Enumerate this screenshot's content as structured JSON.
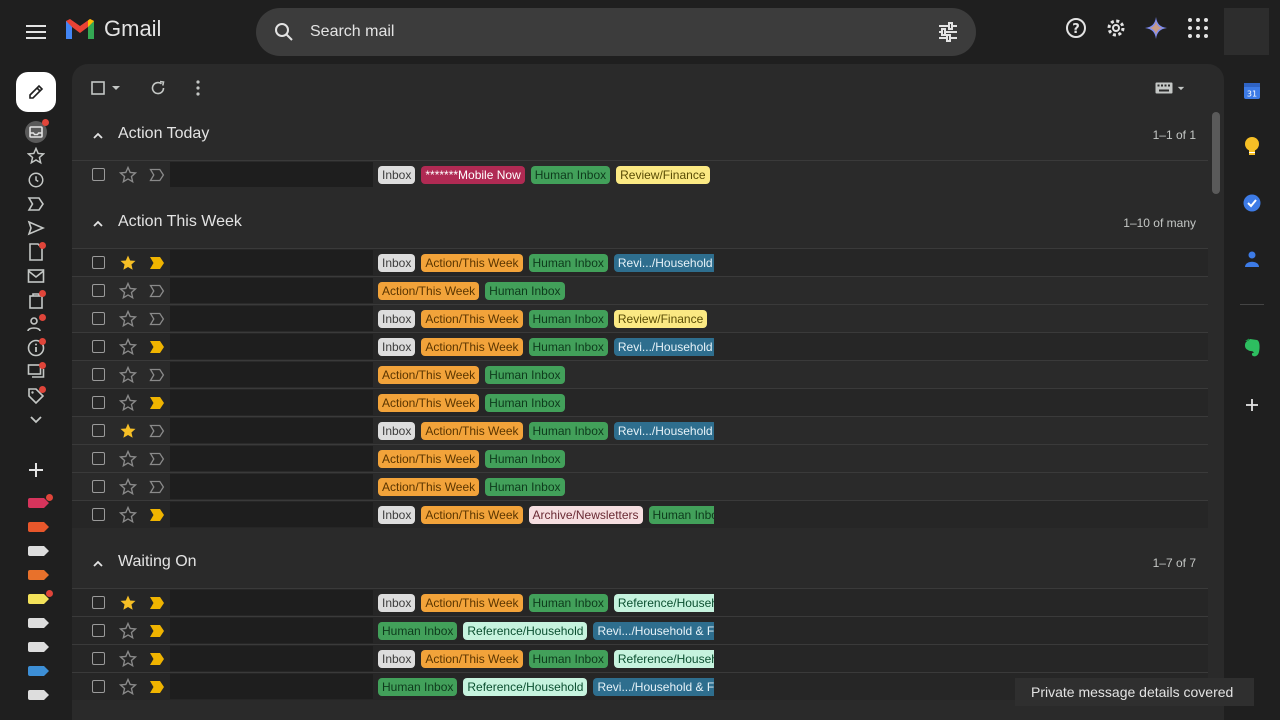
{
  "app": {
    "name": "Gmail"
  },
  "search": {
    "placeholder": "Search mail"
  },
  "sections": [
    {
      "title": "Action Today",
      "count": "1–1 of 1"
    },
    {
      "title": "Action This Week",
      "count": "1–10 of many"
    },
    {
      "title": "Waiting On",
      "count": "1–7 of 7"
    }
  ],
  "rows_today": [
    {
      "starred": false,
      "important": false,
      "labels": [
        {
          "text": "Inbox",
          "cls": "inbox"
        },
        {
          "text": "*******Mobile Now",
          "cls": "mobile"
        },
        {
          "text": "Human Inbox",
          "cls": "human"
        },
        {
          "text": "Review/Finance",
          "cls": "finance"
        }
      ]
    }
  ],
  "rows_week": [
    {
      "starred": true,
      "important": true,
      "labels": [
        {
          "text": "Inbox",
          "cls": "inbox"
        },
        {
          "text": "Action/This Week",
          "cls": "action"
        },
        {
          "text": "Human Inbox",
          "cls": "human"
        },
        {
          "text": "Revi.../Household",
          "cls": "household"
        }
      ]
    },
    {
      "starred": false,
      "important": false,
      "labels": [
        {
          "text": "Action/This Week",
          "cls": "action"
        },
        {
          "text": "Human Inbox",
          "cls": "human"
        }
      ]
    },
    {
      "starred": false,
      "important": false,
      "labels": [
        {
          "text": "Inbox",
          "cls": "inbox"
        },
        {
          "text": "Action/This Week",
          "cls": "action"
        },
        {
          "text": "Human Inbox",
          "cls": "human"
        },
        {
          "text": "Review/Finance",
          "cls": "finance"
        }
      ]
    },
    {
      "starred": false,
      "important": true,
      "labels": [
        {
          "text": "Inbox",
          "cls": "inbox"
        },
        {
          "text": "Action/This Week",
          "cls": "action"
        },
        {
          "text": "Human Inbox",
          "cls": "human"
        },
        {
          "text": "Revi.../Household",
          "cls": "household"
        }
      ]
    },
    {
      "starred": false,
      "important": false,
      "labels": [
        {
          "text": "Action/This Week",
          "cls": "action"
        },
        {
          "text": "Human Inbox",
          "cls": "human"
        }
      ]
    },
    {
      "starred": false,
      "important": true,
      "labels": [
        {
          "text": "Action/This Week",
          "cls": "action"
        },
        {
          "text": "Human Inbox",
          "cls": "human"
        }
      ]
    },
    {
      "starred": true,
      "important": false,
      "labels": [
        {
          "text": "Inbox",
          "cls": "inbox"
        },
        {
          "text": "Action/This Week",
          "cls": "action"
        },
        {
          "text": "Human Inbox",
          "cls": "human"
        },
        {
          "text": "Revi.../Household",
          "cls": "household"
        }
      ]
    },
    {
      "starred": false,
      "important": false,
      "labels": [
        {
          "text": "Action/This Week",
          "cls": "action"
        },
        {
          "text": "Human Inbox",
          "cls": "human"
        }
      ]
    },
    {
      "starred": false,
      "important": false,
      "labels": [
        {
          "text": "Action/This Week",
          "cls": "action"
        },
        {
          "text": "Human Inbox",
          "cls": "human"
        }
      ]
    },
    {
      "starred": false,
      "important": true,
      "labels": [
        {
          "text": "Inbox",
          "cls": "inbox"
        },
        {
          "text": "Action/This Week",
          "cls": "action"
        },
        {
          "text": "Archive/Newsletters",
          "cls": "news"
        },
        {
          "text": "Human Inbox",
          "cls": "human"
        }
      ]
    }
  ],
  "rows_waiting": [
    {
      "starred": true,
      "important": true,
      "labels": [
        {
          "text": "Inbox",
          "cls": "inbox"
        },
        {
          "text": "Action/This Week",
          "cls": "action"
        },
        {
          "text": "Human Inbox",
          "cls": "human"
        },
        {
          "text": "Reference/Household",
          "cls": "ref"
        }
      ]
    },
    {
      "starred": false,
      "important": true,
      "labels": [
        {
          "text": "Human Inbox",
          "cls": "human"
        },
        {
          "text": "Reference/Household",
          "cls": "ref"
        },
        {
          "text": "Revi.../Household & Finance",
          "cls": "household"
        }
      ]
    },
    {
      "starred": false,
      "important": true,
      "labels": [
        {
          "text": "Inbox",
          "cls": "inbox"
        },
        {
          "text": "Action/This Week",
          "cls": "action"
        },
        {
          "text": "Human Inbox",
          "cls": "human"
        },
        {
          "text": "Reference/Household",
          "cls": "ref"
        }
      ]
    },
    {
      "starred": false,
      "important": true,
      "labels": [
        {
          "text": "Human Inbox",
          "cls": "human"
        },
        {
          "text": "Reference/Household",
          "cls": "ref"
        },
        {
          "text": "Revi.../Household & Finance",
          "cls": "household"
        }
      ]
    }
  ],
  "nav_label_colors": [
    "#d6345c",
    "#e8572b",
    "#dddddd",
    "#e8712b",
    "#f3e25a",
    "#dddddd",
    "#dddddd",
    "#3d8fd6",
    "#dddddd"
  ],
  "toast": {
    "text": "Private message details covered"
  }
}
